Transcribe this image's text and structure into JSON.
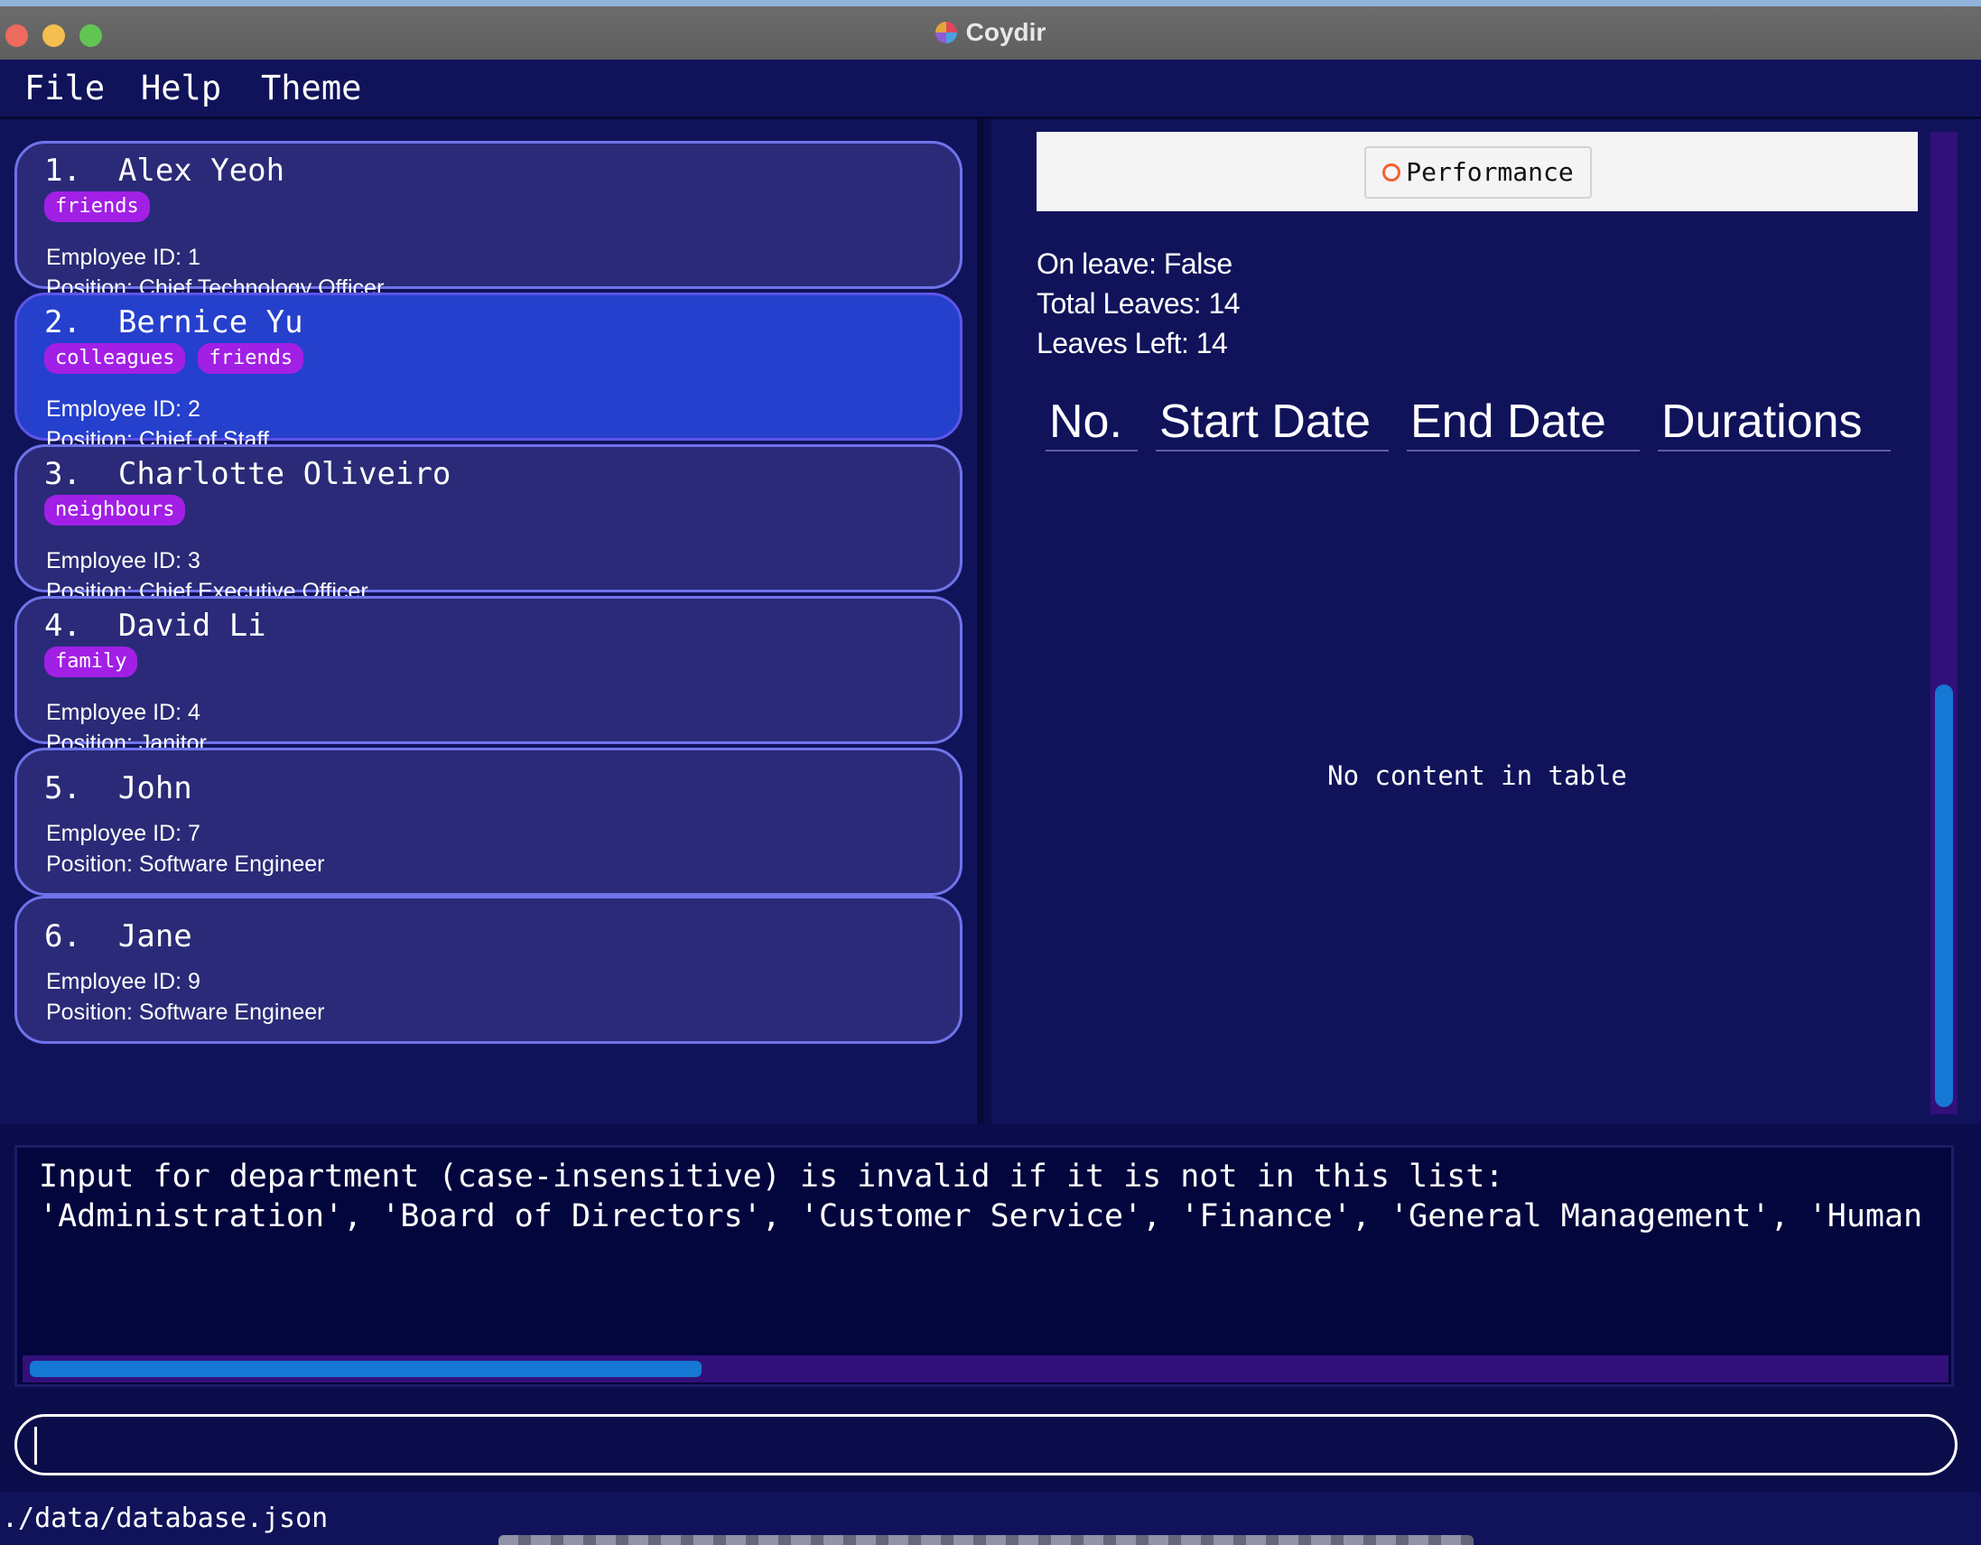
{
  "window": {
    "title": "Coydir"
  },
  "menu": {
    "items": [
      "File",
      "Help",
      "Theme"
    ]
  },
  "employees": [
    {
      "name": "1.  Alex Yeoh",
      "tags": [
        "friends"
      ],
      "id_line": "Employee ID:  1",
      "position_line": "Position:  Chief Technology Officer",
      "selected": false
    },
    {
      "name": "2.  Bernice Yu",
      "tags": [
        "colleagues",
        "friends"
      ],
      "id_line": "Employee ID:  2",
      "position_line": "Position:  Chief of Staff",
      "selected": true
    },
    {
      "name": "3.  Charlotte Oliveiro",
      "tags": [
        "neighbours"
      ],
      "id_line": "Employee ID:  3",
      "position_line": "Position:  Chief Executive Officer",
      "selected": false
    },
    {
      "name": "4.  David Li",
      "tags": [
        "family"
      ],
      "id_line": "Employee ID:  4",
      "position_line": "Position:  Janitor",
      "selected": false
    },
    {
      "name": "5.  John",
      "tags": [],
      "id_line": "Employee ID:  7",
      "position_line": "Position:  Software Engineer",
      "selected": false
    },
    {
      "name": "6.  Jane",
      "tags": [],
      "id_line": "Employee ID:  9",
      "position_line": "Position:  Software Engineer",
      "selected": false
    }
  ],
  "detail": {
    "tab_label": "Performance",
    "on_leave": "On leave: False",
    "total_leaves": "Total Leaves: 14",
    "leaves_left": "Leaves Left: 14",
    "table_headers": [
      "No.",
      "Start Date",
      "End Date",
      "Durations"
    ],
    "empty_message": "No content in table"
  },
  "result": {
    "lines": [
      "Input for department (case-insensitive) is invalid if it is not in this list:",
      "'Administration', 'Board of Directors', 'Customer Service', 'Finance', 'General Management', 'Human"
    ]
  },
  "command": {
    "value": ""
  },
  "status": {
    "path": "./data/database.json"
  },
  "colors": {
    "background": "#10135a",
    "card": "#2a2a78",
    "card_selected": "#2540cc",
    "card_border": "#6f73ea",
    "tag": "#a21fe6",
    "scroll_thumb": "#1478d4",
    "scroll_track": "#32107a"
  }
}
